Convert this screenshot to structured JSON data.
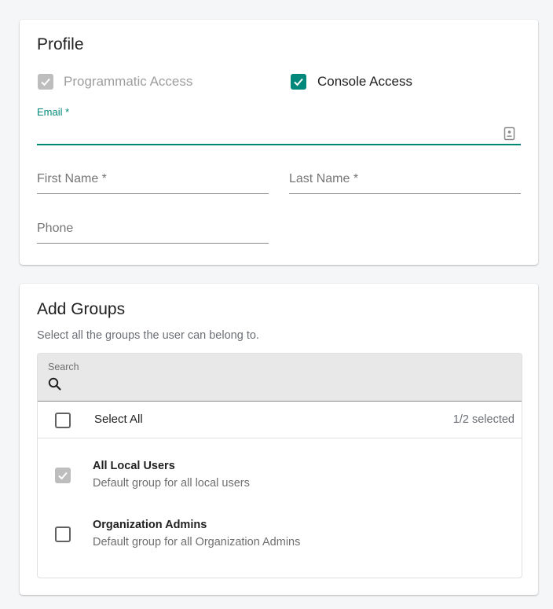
{
  "profile": {
    "title": "Profile",
    "access": {
      "programmatic": {
        "label": "Programmatic Access",
        "checked": true,
        "disabled": true
      },
      "console": {
        "label": "Console Access",
        "checked": true,
        "disabled": false
      }
    },
    "fields": {
      "email": {
        "label": "Email *",
        "value": "",
        "focused": true,
        "icon": "contact-card-icon"
      },
      "first_name": {
        "label": "First Name *",
        "value": ""
      },
      "last_name": {
        "label": "Last Name *",
        "value": ""
      },
      "phone": {
        "label": "Phone",
        "value": ""
      }
    }
  },
  "groups": {
    "title": "Add Groups",
    "subtitle": "Select all the groups the user can belong to.",
    "search": {
      "label": "Search",
      "value": "",
      "icon": "search-icon"
    },
    "select_all": {
      "label": "Select All",
      "checked": false
    },
    "selected_count": "1/2 selected",
    "items": [
      {
        "name": "All Local Users",
        "description": "Default group for all local users",
        "checked": true,
        "disabled": true
      },
      {
        "name": "Organization Admins",
        "description": "Default group for all Organization Admins",
        "checked": false,
        "disabled": false
      }
    ]
  },
  "colors": {
    "accent": "#00897b",
    "disabled": "#bdbdbd",
    "background": "#f5f6f8"
  }
}
